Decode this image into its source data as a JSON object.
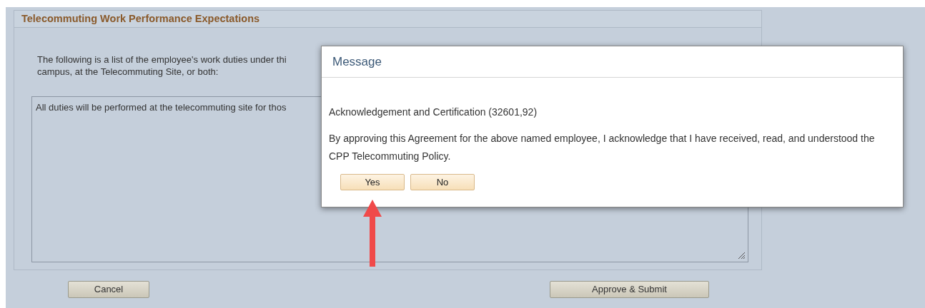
{
  "section": {
    "title": "Telecommuting Work Performance Expectations",
    "intro_lines": [
      "The following is a list of the employee's work duties under thi",
      "campus, at the Telecommuting Site, or both:"
    ],
    "duties_field": {
      "value": "All duties will be performed at the telecommuting site for thos"
    }
  },
  "buttons": [
    "Cancel",
    "Approve & Submit"
  ],
  "dialog": {
    "title": "Message",
    "heading": "Acknowledgement and Certification (32601,92)",
    "body": "By approving this Agreement for the above named employee, I acknowledge that I have received, read, and understood the CPP Telecommuting Policy.",
    "buttons": [
      "Yes",
      "No"
    ]
  }
}
